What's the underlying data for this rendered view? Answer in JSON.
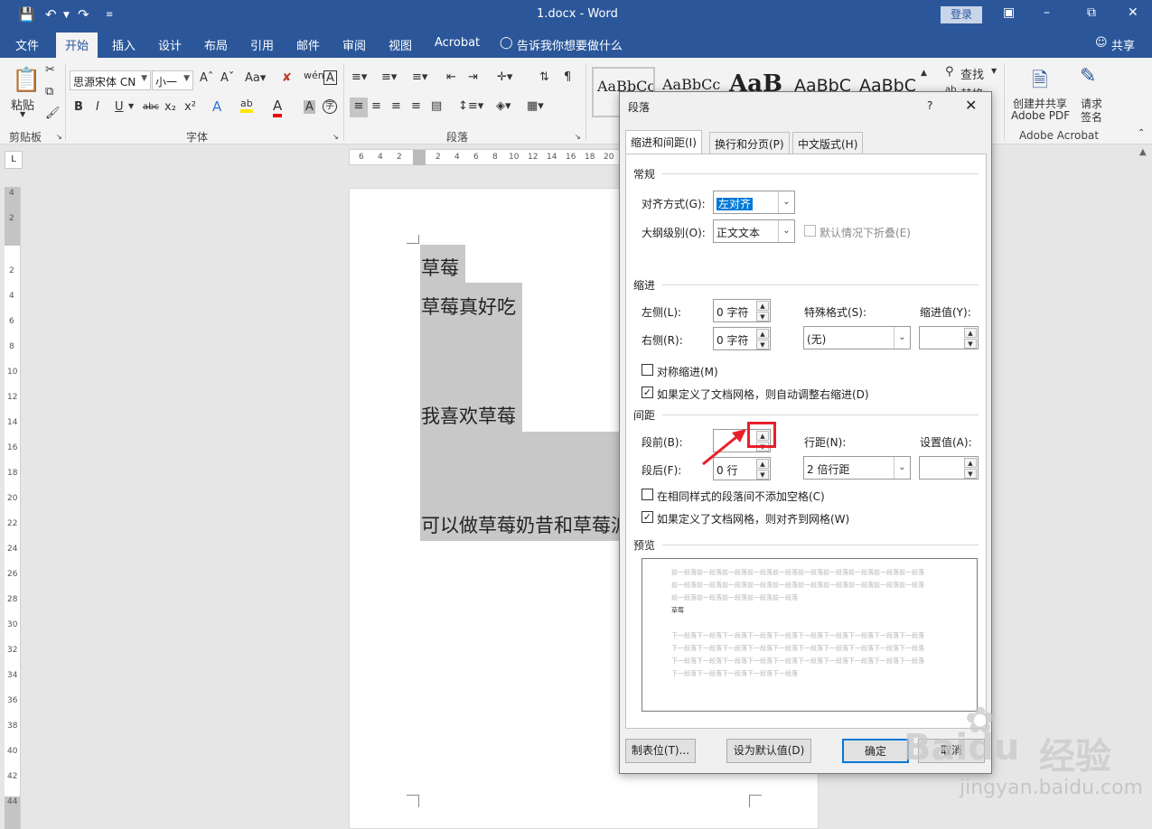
{
  "window": {
    "title": "1.docx - Word",
    "login": "登录"
  },
  "tabs": [
    "文件",
    "开始",
    "插入",
    "设计",
    "布局",
    "引用",
    "邮件",
    "审阅",
    "视图",
    "Acrobat"
  ],
  "active_tab": "开始",
  "tell_me": "告诉我你想要做什么",
  "share": "共享",
  "ribbon": {
    "paste": "粘贴",
    "clipboard": "剪贴板",
    "font_group": "字体",
    "paragraph_group": "段落",
    "font_name": "思源宋体 CN",
    "font_size": "小一",
    "styles": [
      "AaBbCc",
      "AaBbCc",
      "AaB",
      "AaBbC",
      "AaBbC"
    ],
    "find": "查找",
    "replace": "替换",
    "adobe_create_line1": "创建并共享",
    "adobe_create_line2": "Adobe PDF",
    "adobe_sign_line1": "请求",
    "adobe_sign_line2": "签名",
    "adobe_group": "Adobe Acrobat"
  },
  "ruler": {
    "h": [
      "6",
      "4",
      "2",
      "",
      "2",
      "4",
      "6",
      "8",
      "10",
      "12",
      "14",
      "16",
      "18",
      "20"
    ],
    "v": [
      "4",
      "2",
      "",
      "2",
      "4",
      "6",
      "8",
      "10",
      "12",
      "14",
      "16",
      "18",
      "20",
      "22",
      "24",
      "26",
      "28",
      "30",
      "32",
      "34",
      "36",
      "38",
      "40",
      "42",
      "44"
    ]
  },
  "document": {
    "lines": [
      "草莓",
      "草莓真好吃",
      "我喜欢草莓",
      "可以做草莓奶昔和草莓派"
    ]
  },
  "dialog": {
    "title": "段落",
    "help": "?",
    "tabs": [
      "缩进和间距(I)",
      "换行和分页(P)",
      "中文版式(H)"
    ],
    "general": "常规",
    "alignment_label": "对齐方式(G):",
    "alignment_value": "左对齐",
    "outline_label": "大纲级别(O):",
    "outline_value": "正文文本",
    "collapse_label": "默认情况下折叠(E)",
    "indent": "缩进",
    "left_label": "左侧(L):",
    "left_value": "0 字符",
    "right_label": "右侧(R):",
    "right_value": "0 字符",
    "special_label": "特殊格式(S):",
    "special_value": "(无)",
    "indent_by_label": "缩进值(Y):",
    "mirror_label": "对称缩进(M)",
    "auto_right_label": "如果定义了文档网格，则自动调整右缩进(D)",
    "spacing": "间距",
    "before_label": "段前(B):",
    "before_value": "",
    "after_label": "段后(F):",
    "after_value": "0 行",
    "line_spacing_label": "行距(N):",
    "line_spacing_value": "2 倍行距",
    "at_label": "设置值(A):",
    "no_space_label": "在相同样式的段落间不添加空格(C)",
    "snap_grid_label": "如果定义了文档网格，则对齐到网格(W)",
    "preview": "预览",
    "preview_prev": [
      "前一段落前一段落前一段落前一段落前一段落前一段落前一段落前一段落前一段落前一段落",
      "前一段落前一段落前一段落前一段落前一段落前一段落前一段落前一段落前一段落前一段落",
      "前一段落前一段落前一段落前一段落前一段落"
    ],
    "preview_current": "草莓",
    "preview_next": [
      "下一段落下一段落下一段落下一段落下一段落下一段落下一段落下一段落下一段落下一段落",
      "下一段落下一段落下一段落下一段落下一段落下一段落下一段落下一段落下一段落下一段落",
      "下一段落下一段落下一段落下一段落下一段落下一段落下一段落下一段落下一段落下一段落",
      "下一段落下一段落下一段落下一段落下一段落"
    ],
    "tabs_button": "制表位(T)...",
    "default_button": "设为默认值(D)",
    "ok_button": "确定",
    "cancel_button": "取消"
  },
  "watermark": {
    "brand": "Baidu",
    "cn": "经验",
    "url": "jingyan.baidu.com"
  }
}
